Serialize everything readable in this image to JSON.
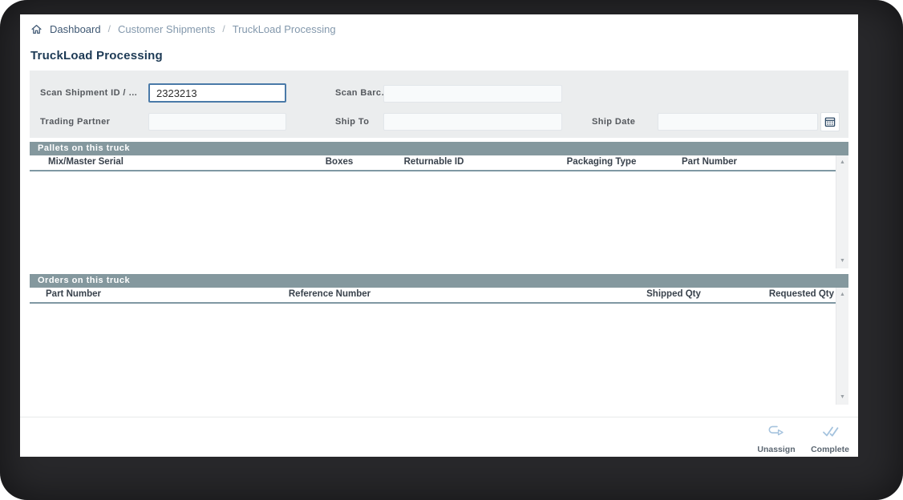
{
  "breadcrumb": {
    "separator": "/",
    "items": [
      {
        "label": "Dashboard"
      },
      {
        "label": "Customer Shipments"
      },
      {
        "label": "TruckLoad Processing"
      }
    ]
  },
  "page": {
    "title": "TruckLoad Processing"
  },
  "form": {
    "fields": [
      {
        "label": "Scan Shipment ID / …",
        "value": "2323213",
        "state": "focused"
      },
      {
        "label": "Scan Barc…",
        "value": ""
      },
      {
        "label": "Trading Partner",
        "value": ""
      },
      {
        "label": "Ship To",
        "value": ""
      },
      {
        "label": "Ship Date",
        "value": "",
        "icon": "calendar-icon"
      }
    ]
  },
  "tables": {
    "pallets": {
      "title": "Pallets on this truck",
      "columns": [
        "Mix/Master Serial",
        "Boxes",
        "Returnable ID",
        "Packaging Type",
        "Part Number"
      ],
      "rows": []
    },
    "orders": {
      "title": "Orders on this truck",
      "columns": [
        "Part Number",
        "Reference Number",
        "Shipped Qty",
        "Requested Qty"
      ],
      "rows": []
    }
  },
  "scrollbar": {
    "up_glyph": "▲",
    "down_glyph": "▼"
  },
  "toolbar": {
    "buttons": [
      {
        "label": "Unassign",
        "icon": "unassign-icon"
      },
      {
        "label": "Complete",
        "icon": "complete-icon"
      }
    ]
  },
  "colors": {
    "section_header_bg": "#84989e",
    "focused_input_border": "#4a7aa8",
    "title_color": "#1d3a55",
    "breadcrumb_active": "#3f5873",
    "breadcrumb_link": "#8398ac",
    "toolbar_icon_blue": "#a5c3de",
    "frame_dark": "#28282b"
  }
}
